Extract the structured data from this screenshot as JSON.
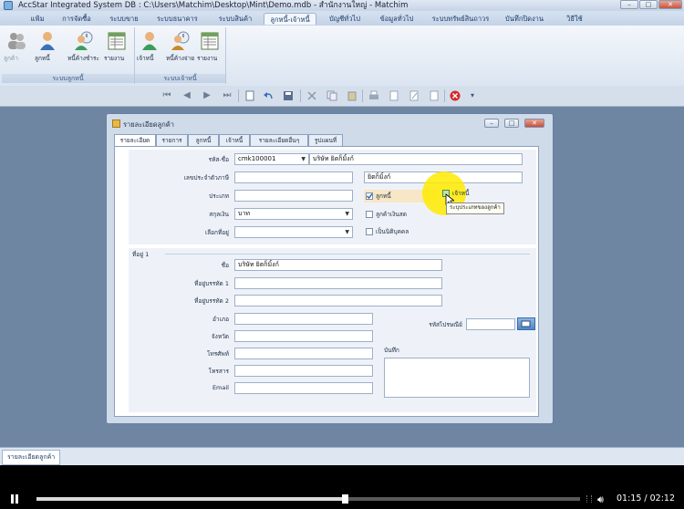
{
  "window": {
    "title": "AccStar Integrated System DB : C:\\Users\\Matchim\\Desktop\\Mint\\Demo.mdb - สำนักงานใหญ่ - Matchim",
    "min": "–",
    "max": "□",
    "close": "✕"
  },
  "menu_tabs": [
    {
      "label": "แฟ้ม"
    },
    {
      "label": "การจัดซื้อ"
    },
    {
      "label": "ระบบขาย"
    },
    {
      "label": "ระบบธนาคาร"
    },
    {
      "label": "ระบบสินค้า"
    },
    {
      "label": "ลูกหนี้-เจ้าหนี้",
      "active": true
    },
    {
      "label": "บัญชีทั่วไป"
    },
    {
      "label": "ข้อมูลทั่วไป"
    },
    {
      "label": "ระบบทรัพย์สินถาวร"
    },
    {
      "label": "บันทึกปิดงาน"
    },
    {
      "label": "วิธีใช้"
    }
  ],
  "ribbon": {
    "group1": {
      "label": "ระบบลูกหนี้",
      "buttons": [
        {
          "label": "ลูกค้า",
          "icon": "people-icon"
        },
        {
          "label": "ลูกหนี้",
          "icon": "person-icon"
        },
        {
          "label": "หนี้ค้างชำระ",
          "icon": "clock-person-icon"
        },
        {
          "label": "รายงาน",
          "icon": "report-icon"
        }
      ]
    },
    "group2": {
      "label": "ระบบเจ้าหนี้",
      "buttons": [
        {
          "label": "เจ้าหนี้",
          "icon": "person-icon"
        },
        {
          "label": "หนี้ค้างจ่าย",
          "icon": "clock-person-icon"
        },
        {
          "label": "รายงาน",
          "icon": "report-icon"
        }
      ]
    }
  },
  "toolbar": {
    "first": "⏮",
    "prev": "◀",
    "next": "▶",
    "last": "⏭",
    "cancel_icon": "⊘",
    "close": "✖",
    "extra": "▾"
  },
  "dialog": {
    "title": "รายละเอียดลูกค้า",
    "tabs": [
      {
        "label": "รายละเอียด",
        "active": true
      },
      {
        "label": "รายการ"
      },
      {
        "label": "ลูกหนี้"
      },
      {
        "label": "เจ้าหนี้"
      },
      {
        "label": "รายละเอียดอื่นๆ"
      },
      {
        "label": "รูปแผนที่"
      }
    ],
    "fields": {
      "code_label": "รหัส-ชื่อ",
      "code_value": "cmk100001",
      "name_value": "บริษัท ยิตก็มิ้งก์",
      "taxid_label": "เลขประจำตัวภาษี",
      "taxid_value": "",
      "alias_value": "ยิตก็มิ้งก์",
      "type_label": "ประเภท",
      "type_value": "",
      "currency_label": "สกุลเงิน",
      "currency_value": "บาท",
      "address_sel_label": "เลือกที่อยู่",
      "address_sel_value": "",
      "chk_debtor": "ลูกหนี้",
      "chk_creditor": "เจ้าหนี้",
      "chk_cash": "ลูกค้าเงินสด",
      "chk_person": "เป็นนิติบุคคล",
      "tooltip": "ระบุประเภทของลูกค้า"
    },
    "address": {
      "section_label": "ที่อยู่ 1",
      "name_label": "ชื่อ",
      "name_value": "บริษัท ยิตก็มิ้งก์",
      "addr1_label": "ที่อยู่บรรทัด 1",
      "addr2_label": "ที่อยู่บรรทัด 2",
      "district_label": "อำเภอ",
      "province_label": "จังหวัด",
      "phone_label": "โทรศัพท์",
      "fax_label": "โทรสาร",
      "email_label": "Email",
      "zip_label": "รหัสไปรษณีย์",
      "note_label": "บันทึก"
    }
  },
  "status_tab": "รายละเอียดลูกค้า",
  "video": {
    "time": "01:15 / 02:12",
    "progress": 0.567
  }
}
